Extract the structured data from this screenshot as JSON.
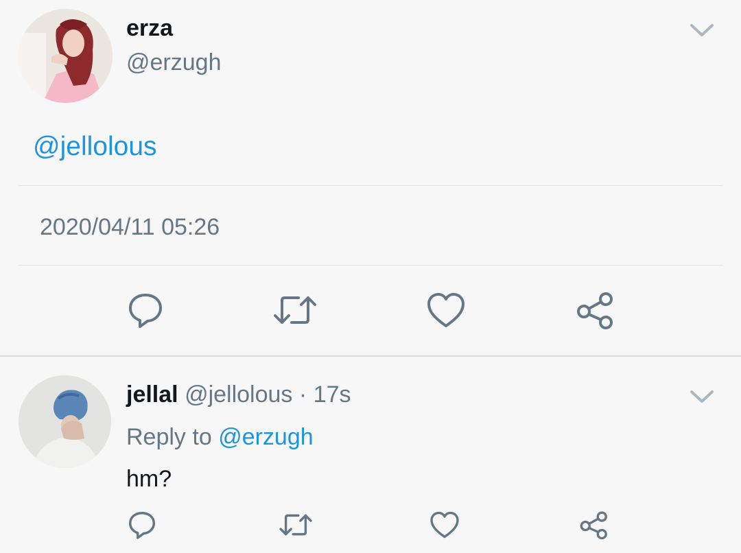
{
  "tweet": {
    "author": {
      "display_name": "erza",
      "handle": "@erzugh"
    },
    "text": "@jellolous",
    "timestamp": "2020/04/11 05:26",
    "actions": [
      "reply-icon",
      "retweet-icon",
      "like-icon",
      "share-icon"
    ],
    "menu_icon": "chevron-down-icon"
  },
  "reply": {
    "author": {
      "display_name": "jellal",
      "handle": "@jellolous",
      "separator": "·",
      "age": "17s"
    },
    "reply_to_prefix": "Reply to",
    "reply_to_handle": "@erzugh",
    "text": "hm?",
    "actions": [
      "reply-icon",
      "retweet-icon",
      "like-icon",
      "share-icon"
    ],
    "menu_icon": "chevron-down-icon"
  },
  "colors": {
    "background": "#f7f7f8",
    "text_primary": "#14171a",
    "text_secondary": "#657786",
    "link": "#1b95e0",
    "divider": "#e1e4e7"
  }
}
